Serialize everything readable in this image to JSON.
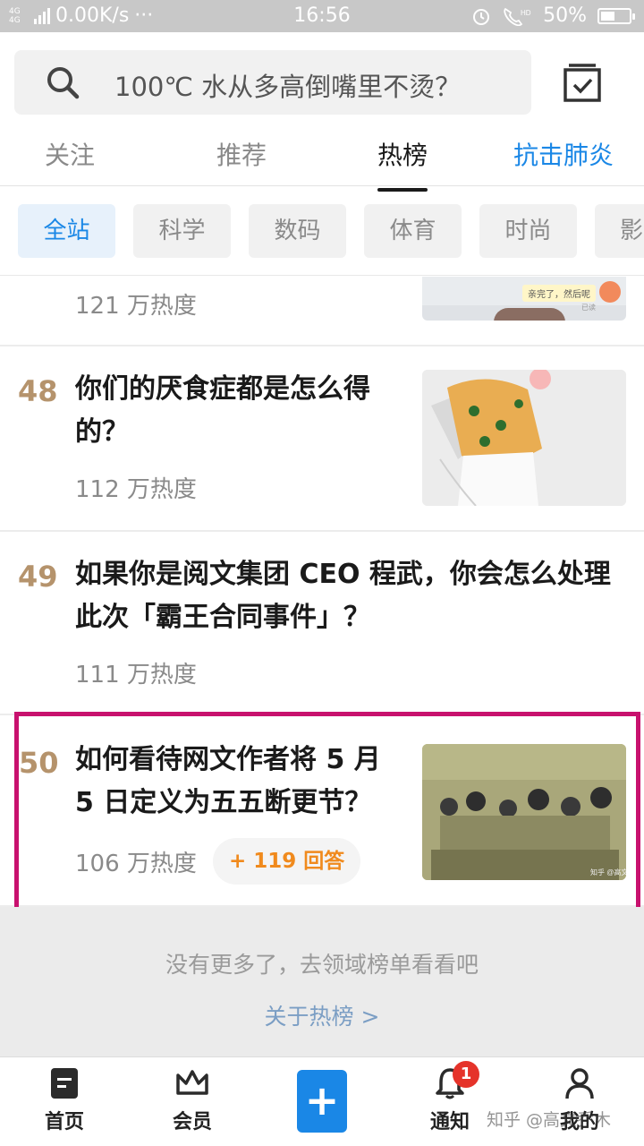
{
  "status_bar": {
    "signal": "4G 4G",
    "speed": "0.00K/s",
    "dots": "···",
    "time": "16:56",
    "battery": "50%",
    "battery_level": 0.5,
    "alarm_icon": "alarm-clock-icon",
    "call_icon": "hd-call-icon"
  },
  "search": {
    "placeholder": "100℃ 水从多高倒嘴里不烫？",
    "icon": "search-icon",
    "checkin_icon": "checkin-calendar-icon"
  },
  "tabs": [
    {
      "label": "关注"
    },
    {
      "label": "推荐"
    },
    {
      "label": "热榜"
    },
    {
      "label": "抗击肺炎"
    }
  ],
  "active_tab": "热榜",
  "chips": [
    {
      "label": "全站"
    },
    {
      "label": "科学"
    },
    {
      "label": "数码"
    },
    {
      "label": "体育"
    },
    {
      "label": "时尚"
    },
    {
      "label": "影"
    }
  ],
  "items": [
    {
      "rank": "",
      "title": "",
      "heat": "121 万热度",
      "thumb_caption": "亲完了，然后呢",
      "thumb_sub": "已读"
    },
    {
      "rank": "48",
      "title": "你们的厌食症都是怎么得的？",
      "heat": "112 万热度"
    },
    {
      "rank": "49",
      "title": "如果你是阅文集团 CEO 程武，你会怎么处理此次「霸王合同事件」？",
      "heat": "111 万热度"
    },
    {
      "rank": "50",
      "title": "如何看待网文作者将 5 月 5 日定义为五五断更节？",
      "heat": "106 万热度",
      "answers": "+ 119 回答",
      "thumb_caption": "知乎 @高文"
    }
  ],
  "footer": {
    "no_more": "没有更多了，去领域榜单看看吧",
    "about": "关于热榜 >"
  },
  "bottom_nav": [
    {
      "label": "首页",
      "icon": "home-icon"
    },
    {
      "label": "会员",
      "icon": "crown-icon"
    },
    {
      "label": "",
      "icon": "plus-icon",
      "glyph": "+"
    },
    {
      "label": "通知",
      "icon": "bell-icon",
      "badge": "1"
    },
    {
      "label": "我的",
      "icon": "person-icon"
    }
  ],
  "watermark": "知乎 @高文乔木",
  "colors": {
    "accent": "#1a87e6",
    "rank": "#b5936c",
    "highlight_border": "#c8116e",
    "answers": "#f08a1d",
    "badge": "#e5332a"
  }
}
